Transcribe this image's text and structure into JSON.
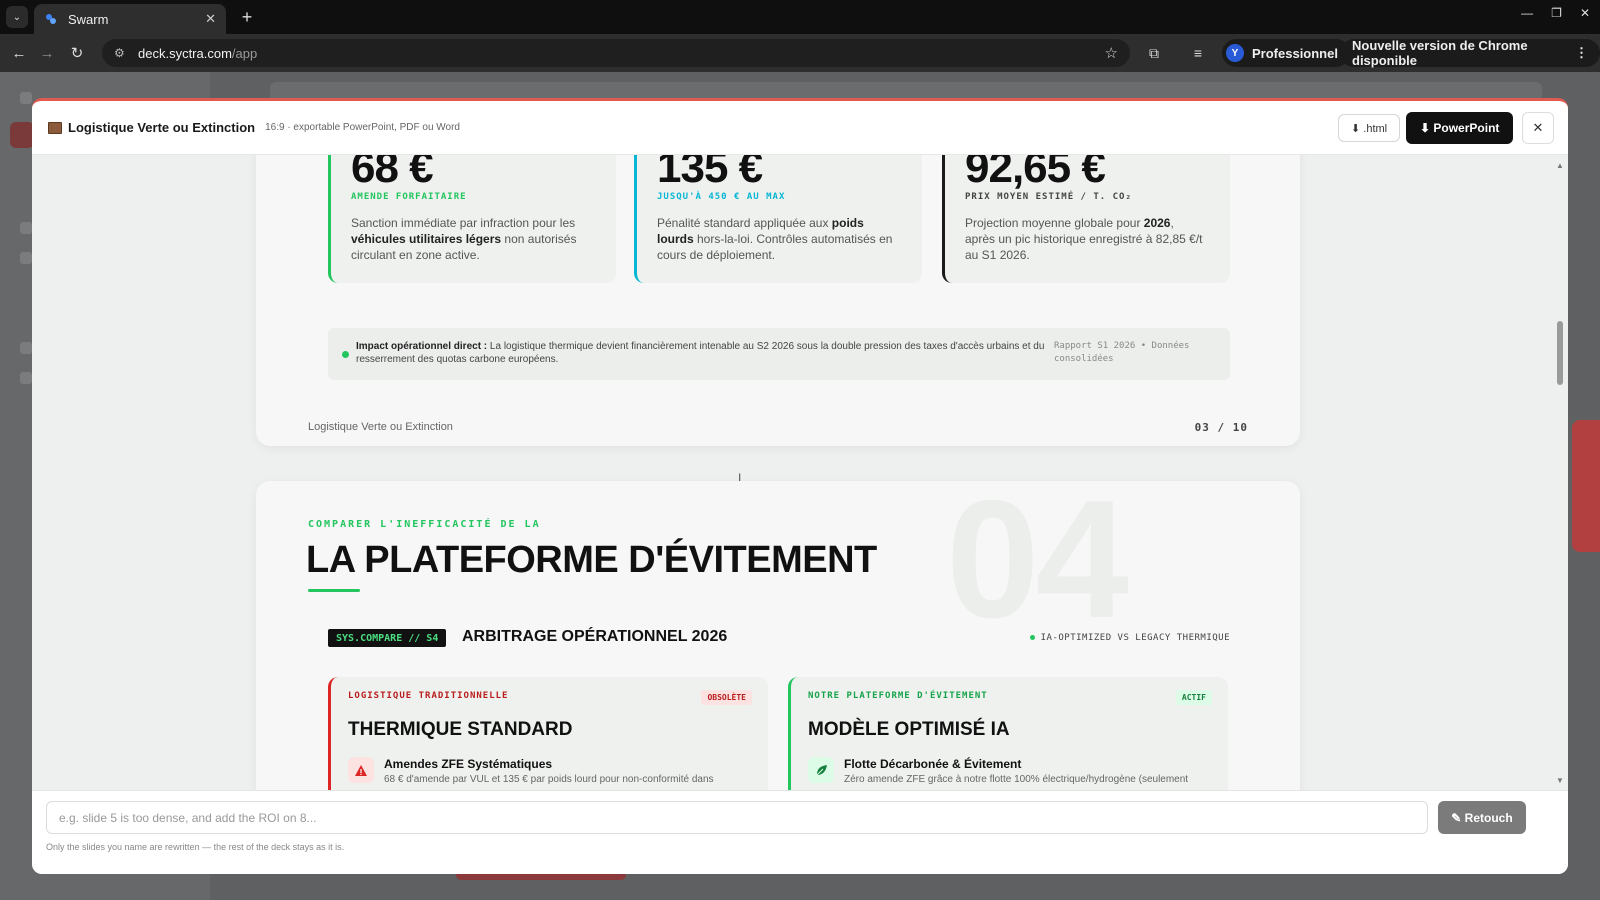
{
  "browser": {
    "tab_title": "Swarm",
    "url_domain": "deck.syctra.com",
    "url_path": "/app",
    "profile_initial": "Y",
    "profile_label": "Professionnel",
    "update_label": "Nouvelle version de Chrome disponible"
  },
  "modal": {
    "title": "Logistique Verte ou Extinction",
    "subtitle": "16:9 · exportable PowerPoint, PDF ou Word",
    "html_button": "⬇ .html",
    "ppt_button": "⬇ PowerPoint",
    "close": "✕"
  },
  "slide3": {
    "stats": [
      {
        "value": "68 €",
        "caption": "AMENDE FORFAITAIRE",
        "caption_color": "#22c55e",
        "accent": "#22c55e",
        "desc_pre": "Sanction immédiate par infraction pour les ",
        "desc_bold": "véhicules utilitaires légers",
        "desc_post": " non autorisés circulant en zone active."
      },
      {
        "value": "135 €",
        "caption": "JUSQU'À 450 € AU MAX",
        "caption_color": "#06b6d4",
        "accent": "#06b6d4",
        "desc_pre": "Pénalité standard appliquée aux ",
        "desc_bold": "poids lourds",
        "desc_post": " hors-la-loi. Contrôles automatisés en cours de déploiement."
      },
      {
        "value": "92,65 €",
        "caption": "PRIX MOYEN ESTIMÉ / T. CO₂",
        "caption_color": "#444444",
        "accent": "#1a1a1a",
        "desc_pre": "Projection moyenne globale pour ",
        "desc_bold": "2026",
        "desc_post": ", après un pic historique enregistré à 82,85 €/t au S1 2026."
      }
    ],
    "impact_label": "Impact opérationnel direct :",
    "impact_text": " La logistique thermique devient financièrement intenable au S2 2026 sous la double pression des taxes d'accès urbains et du resserrement des quotas carbone européens.",
    "impact_source": "Rapport S1 2026 • Données consolidées",
    "footer_title": "Logistique Verte ou Extinction",
    "page_number": "03 / 10"
  },
  "slide4": {
    "watermark": "04",
    "kicker": "COMPARER L'INEFFICACITÉ DE LA",
    "title": "LA PLATEFORME D'ÉVITEMENT",
    "sys_badge": "SYS.COMPARE // S4",
    "arbitrage_title": "ARBITRAGE OPÉRATIONNEL 2026",
    "legacy_note": "IA-OPTIMIZED VS LEGACY THERMIQUE",
    "left_card": {
      "label": "LOGISTIQUE TRADITIONNELLE",
      "badge": "OBSOLÈTE",
      "title": "THERMIQUE STANDARD",
      "item_title": "Amendes ZFE Systématiques",
      "item_desc": "68 € d'amende par VUL et 135 € par poids lourd pour non-conformité dans",
      "accent": "#dc2626"
    },
    "right_card": {
      "label": "NOTRE PLATEFORME D'ÉVITEMENT",
      "badge": "ACTIF",
      "title": "MODÈLE OPTIMISÉ IA",
      "item_title": "Flotte Décarbonée & Évitement",
      "item_desc": "Zéro amende ZFE grâce à notre flotte 100% électrique/hydrogène (seulement",
      "accent": "#22c55e"
    }
  },
  "prompt": {
    "placeholder": "e.g. slide 5 is too dense, and add the ROI on 8...",
    "retouch_button": "✎ Retouch",
    "hint": "Only the slides you name are rewritten — the rest of the deck stays as it is."
  }
}
